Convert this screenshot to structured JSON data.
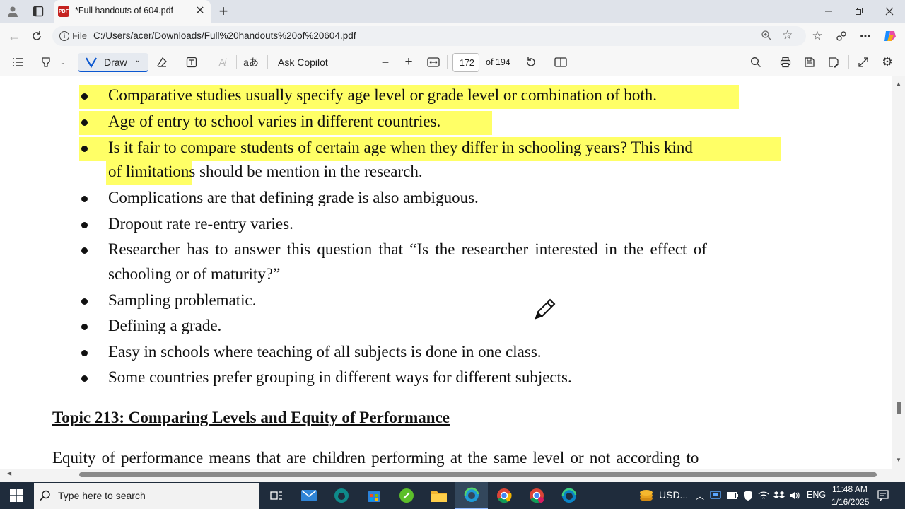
{
  "browser": {
    "tab_title": "*Full handouts of 604.pdf",
    "tab_icon": "pdf-icon",
    "file_label": "File",
    "url": "C:/Users/acer/Downloads/Full%20handouts%20of%20604.pdf"
  },
  "pdf_toolbar": {
    "draw_label": "Draw",
    "copilot_label": "Ask Copilot",
    "page_number": "172",
    "page_total": "of 194",
    "read_aloud_glyph": "aあ"
  },
  "document": {
    "highlighted_bullets": [
      "Comparative studies usually specify age level or grade level or combination of both.",
      "Age of entry to school varies in different countries."
    ],
    "fair_line1": "Is it fair to compare students of certain age when they differ in schooling years? This kind",
    "fair_line2_highlight": "of limitatio",
    "fair_line2_rest": "ns should be mention in the research.",
    "bullets": [
      "Complications are that defining grade is also ambiguous.",
      "Dropout rate re-entry varies."
    ],
    "researcher_line1": "Researcher has to answer this question that “Is the researcher interested in the effect of",
    "researcher_line2": "schooling or of maturity?”",
    "bullets2": [
      "Sampling problematic.",
      "Defining a grade.",
      "Easy in schools where teaching of all subjects is done in one class.",
      "Some countries prefer grouping in different ways for different subjects."
    ],
    "topic_heading": "Topic 213: Comparing Levels and Equity of Performance",
    "paragraph": "Equity of performance means that are children performing at the same level or not according to"
  },
  "taskbar": {
    "search_placeholder": "Type here to search",
    "weather_label": "USD...",
    "language": "ENG",
    "time": "11:48 AM",
    "date": "1/16/2025"
  },
  "colors": {
    "highlight": "#ffff66",
    "taskbar": "#1f2c3c",
    "accent": "#0b57d0"
  }
}
